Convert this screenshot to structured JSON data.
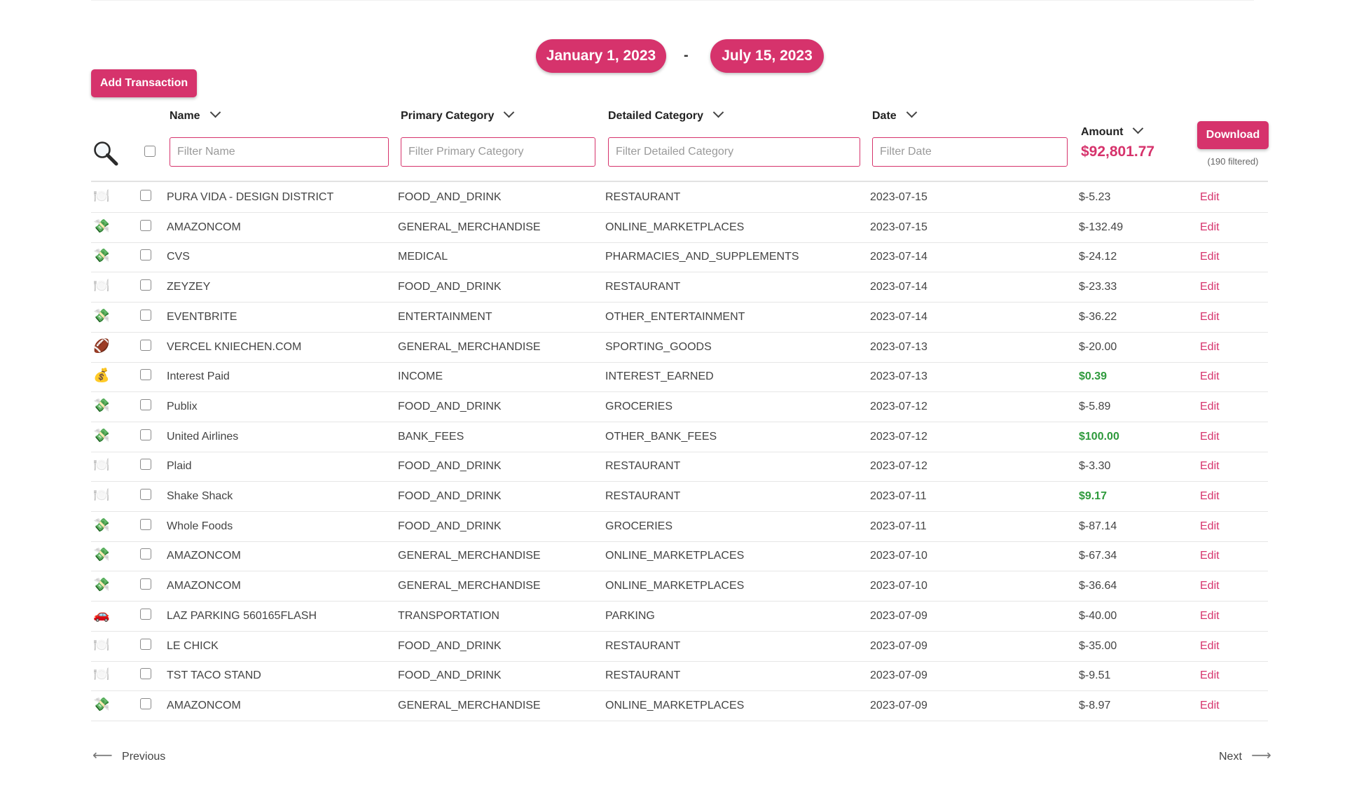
{
  "date_range": {
    "start": "January 1, 2023",
    "separator": "-",
    "end": "July 15, 2023"
  },
  "toolbar": {
    "add_label": "Add Transaction",
    "download_label": "Download",
    "filtered_note": "(190 filtered)"
  },
  "columns": {
    "name": {
      "label": "Name",
      "placeholder": "Filter Name"
    },
    "primary": {
      "label": "Primary Category",
      "placeholder": "Filter Primary Category"
    },
    "detailed": {
      "label": "Detailed Category",
      "placeholder": "Filter Detailed Category"
    },
    "date": {
      "label": "Date",
      "placeholder": "Filter Date"
    },
    "amount": {
      "label": "Amount",
      "total": "$92,801.77"
    }
  },
  "rows": [
    {
      "icon": "🍽️",
      "icon_name": "plate-icon",
      "name": "PURA VIDA - DESIGN DISTRICT",
      "primary": "FOOD_AND_DRINK",
      "detailed": "RESTAURANT",
      "date": "2023-07-15",
      "amount": "$-5.23",
      "positive": false,
      "edit": "Edit"
    },
    {
      "icon": "💸",
      "icon_name": "money-wings-icon",
      "name": "AMAZONCOM",
      "primary": "GENERAL_MERCHANDISE",
      "detailed": "ONLINE_MARKETPLACES",
      "date": "2023-07-15",
      "amount": "$-132.49",
      "positive": false,
      "edit": "Edit"
    },
    {
      "icon": "💸",
      "icon_name": "money-wings-icon",
      "name": "CVS",
      "primary": "MEDICAL",
      "detailed": "PHARMACIES_AND_SUPPLEMENTS",
      "date": "2023-07-14",
      "amount": "$-24.12",
      "positive": false,
      "edit": "Edit"
    },
    {
      "icon": "🍽️",
      "icon_name": "plate-icon",
      "name": "ZEYZEY",
      "primary": "FOOD_AND_DRINK",
      "detailed": "RESTAURANT",
      "date": "2023-07-14",
      "amount": "$-23.33",
      "positive": false,
      "edit": "Edit"
    },
    {
      "icon": "💸",
      "icon_name": "money-wings-icon",
      "name": "EVENTBRITE",
      "primary": "ENTERTAINMENT",
      "detailed": "OTHER_ENTERTAINMENT",
      "date": "2023-07-14",
      "amount": "$-36.22",
      "positive": false,
      "edit": "Edit"
    },
    {
      "icon": "🏈",
      "icon_name": "football-icon",
      "name": "VERCEL KNIECHEN.COM",
      "primary": "GENERAL_MERCHANDISE",
      "detailed": "SPORTING_GOODS",
      "date": "2023-07-13",
      "amount": "$-20.00",
      "positive": false,
      "edit": "Edit"
    },
    {
      "icon": "💰",
      "icon_name": "money-bag-icon",
      "name": "Interest Paid",
      "primary": "INCOME",
      "detailed": "INTEREST_EARNED",
      "date": "2023-07-13",
      "amount": "$0.39",
      "positive": true,
      "edit": "Edit"
    },
    {
      "icon": "💸",
      "icon_name": "money-wings-icon",
      "name": "Publix",
      "primary": "FOOD_AND_DRINK",
      "detailed": "GROCERIES",
      "date": "2023-07-12",
      "amount": "$-5.89",
      "positive": false,
      "edit": "Edit"
    },
    {
      "icon": "💸",
      "icon_name": "money-wings-icon",
      "name": "United Airlines",
      "primary": "BANK_FEES",
      "detailed": "OTHER_BANK_FEES",
      "date": "2023-07-12",
      "amount": "$100.00",
      "positive": true,
      "edit": "Edit"
    },
    {
      "icon": "🍽️",
      "icon_name": "plate-icon",
      "name": "Plaid",
      "primary": "FOOD_AND_DRINK",
      "detailed": "RESTAURANT",
      "date": "2023-07-12",
      "amount": "$-3.30",
      "positive": false,
      "edit": "Edit"
    },
    {
      "icon": "🍽️",
      "icon_name": "plate-icon",
      "name": "Shake Shack",
      "primary": "FOOD_AND_DRINK",
      "detailed": "RESTAURANT",
      "date": "2023-07-11",
      "amount": "$9.17",
      "positive": true,
      "edit": "Edit"
    },
    {
      "icon": "💸",
      "icon_name": "money-wings-icon",
      "name": "Whole Foods",
      "primary": "FOOD_AND_DRINK",
      "detailed": "GROCERIES",
      "date": "2023-07-11",
      "amount": "$-87.14",
      "positive": false,
      "edit": "Edit"
    },
    {
      "icon": "💸",
      "icon_name": "money-wings-icon",
      "name": "AMAZONCOM",
      "primary": "GENERAL_MERCHANDISE",
      "detailed": "ONLINE_MARKETPLACES",
      "date": "2023-07-10",
      "amount": "$-67.34",
      "positive": false,
      "edit": "Edit"
    },
    {
      "icon": "💸",
      "icon_name": "money-wings-icon",
      "name": "AMAZONCOM",
      "primary": "GENERAL_MERCHANDISE",
      "detailed": "ONLINE_MARKETPLACES",
      "date": "2023-07-10",
      "amount": "$-36.64",
      "positive": false,
      "edit": "Edit"
    },
    {
      "icon": "🚗",
      "icon_name": "car-icon",
      "name": "LAZ PARKING 560165FLASH",
      "primary": "TRANSPORTATION",
      "detailed": "PARKING",
      "date": "2023-07-09",
      "amount": "$-40.00",
      "positive": false,
      "edit": "Edit"
    },
    {
      "icon": "🍽️",
      "icon_name": "plate-icon",
      "name": "LE CHICK",
      "primary": "FOOD_AND_DRINK",
      "detailed": "RESTAURANT",
      "date": "2023-07-09",
      "amount": "$-35.00",
      "positive": false,
      "edit": "Edit"
    },
    {
      "icon": "🍽️",
      "icon_name": "plate-icon",
      "name": "TST TACO STAND",
      "primary": "FOOD_AND_DRINK",
      "detailed": "RESTAURANT",
      "date": "2023-07-09",
      "amount": "$-9.51",
      "positive": false,
      "edit": "Edit"
    },
    {
      "icon": "💸",
      "icon_name": "money-wings-icon",
      "name": "AMAZONCOM",
      "primary": "GENERAL_MERCHANDISE",
      "detailed": "ONLINE_MARKETPLACES",
      "date": "2023-07-09",
      "amount": "$-8.97",
      "positive": false,
      "edit": "Edit"
    }
  ],
  "pagination": {
    "previous": "Previous",
    "next": "Next"
  },
  "colors": {
    "accent": "#d6336c",
    "positive": "#2e9a3c"
  }
}
